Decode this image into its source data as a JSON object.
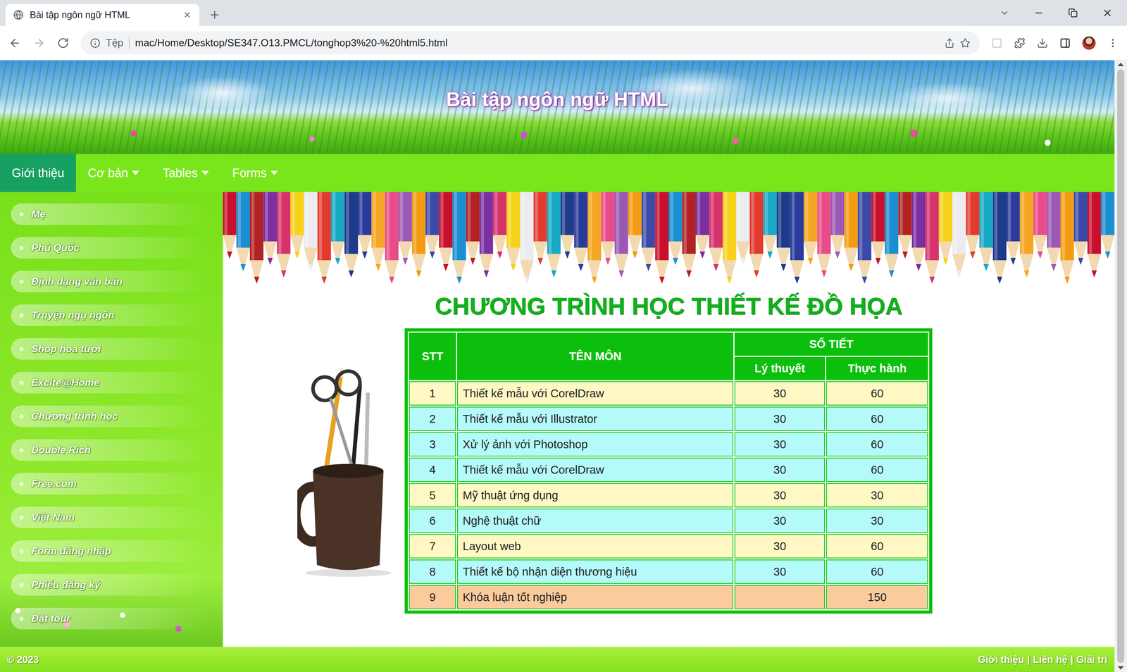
{
  "browser": {
    "tab_title": "Bài tập ngôn ngữ HTML",
    "scheme_label": "Tệp",
    "url": "mac/Home/Desktop/SE347.O13.PMCL/tonghop3%20-%20html5.html"
  },
  "header": {
    "title": "Bài tập ngôn ngữ HTML"
  },
  "nav": [
    {
      "label": "Giới thiệu",
      "selected": true,
      "has_dropdown": false
    },
    {
      "label": "Cơ bản",
      "selected": false,
      "has_dropdown": true
    },
    {
      "label": "Tables",
      "selected": false,
      "has_dropdown": true
    },
    {
      "label": "Forms",
      "selected": false,
      "has_dropdown": true
    }
  ],
  "sidebar": {
    "items": [
      "Mẹ",
      "Phú Quốc",
      "Định dạng văn bản",
      "Truyện ngụ ngôn",
      "Shop hoa tươi",
      "Excite@Home",
      "Chương trình học",
      "Double Rich",
      "Free.com",
      "Việt Nam",
      "Form đăng nhập",
      "Phiếu đăng ký",
      "Đặt tour"
    ]
  },
  "content": {
    "title": "CHƯƠNG TRÌNH HỌC THIẾT KẾ ĐỒ HỌA"
  },
  "table": {
    "header": {
      "index": "STT",
      "name": "TÊN MÔN",
      "group": "SỐ TIẾT",
      "theory": "Lý thuyết",
      "practice": "Thực hành"
    },
    "rows": [
      {
        "index": "1",
        "name": "Thiết kế mẫu với CorelDraw",
        "theory": "30",
        "practice": "60",
        "color": "#fff8c4"
      },
      {
        "index": "2",
        "name": "Thiết kế mẫu với Illustrator",
        "theory": "30",
        "practice": "60",
        "color": "#b4fafa"
      },
      {
        "index": "3",
        "name": "Xử lý ảnh với Photoshop",
        "theory": "30",
        "practice": "60",
        "color": "#b4fafa"
      },
      {
        "index": "4",
        "name": "Thiết kế mẫu với CorelDraw",
        "theory": "30",
        "practice": "60",
        "color": "#b4fafa"
      },
      {
        "index": "5",
        "name": "Mỹ thuật ứng dụng",
        "theory": "30",
        "practice": "30",
        "color": "#fff8c4"
      },
      {
        "index": "6",
        "name": "Nghệ thuật chữ",
        "theory": "30",
        "practice": "30",
        "color": "#b4fafa"
      },
      {
        "index": "7",
        "name": "Layout web",
        "theory": "30",
        "practice": "60",
        "color": "#fff8c4"
      },
      {
        "index": "8",
        "name": "Thiết kế bộ nhận diện thương hiệu",
        "theory": "30",
        "practice": "60",
        "color": "#b4fafa"
      },
      {
        "index": "9",
        "name": "Khóa luận tốt nghiệp",
        "theory": "",
        "practice": "150",
        "color": "#fccb9c"
      }
    ]
  },
  "footer": {
    "copyright": "© 2023",
    "links": [
      "Giới thiệu",
      "Liên hệ",
      "Giải trí"
    ],
    "separator": "|"
  }
}
